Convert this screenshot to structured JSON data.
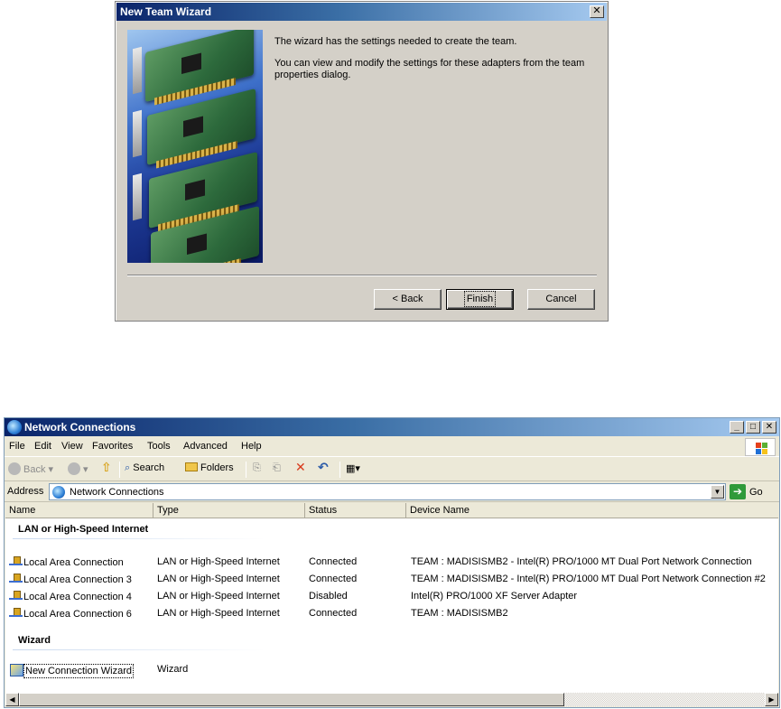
{
  "wizard": {
    "title": "New Team Wizard",
    "close": "✕",
    "message1": "The wizard has the settings needed to create the team.",
    "message2": "You can view and modify the settings for these adapters from the team properties dialog.",
    "back_label": "< Back",
    "finish_label": "Finish",
    "cancel_label": "Cancel"
  },
  "explorer": {
    "title": "Network Connections",
    "controls": {
      "minimize": "_",
      "maximize": "□",
      "close": "✕"
    },
    "menu": [
      "File",
      "Edit",
      "View",
      "Favorites",
      "Tools",
      "Advanced",
      "Help"
    ],
    "toolbar": {
      "back": "Back",
      "search": "Search",
      "folders": "Folders"
    },
    "address": {
      "label": "Address",
      "value": "Network Connections",
      "go": "Go"
    },
    "columns": [
      "Name",
      "Type",
      "Status",
      "Device Name"
    ],
    "groups": {
      "lan": "LAN or High-Speed Internet",
      "wizard": "Wizard"
    },
    "rows": [
      {
        "name": "Local Area Connection",
        "type": "LAN or High-Speed Internet",
        "status": "Connected",
        "device": "TEAM : MADISISMB2 - Intel(R) PRO/1000 MT Dual Port Network Connection"
      },
      {
        "name": "Local Area Connection 3",
        "type": "LAN or High-Speed Internet",
        "status": "Connected",
        "device": "TEAM : MADISISMB2 - Intel(R) PRO/1000 MT Dual Port Network Connection #2"
      },
      {
        "name": "Local Area Connection 4",
        "type": "LAN or High-Speed Internet",
        "status": "Disabled",
        "device": "Intel(R) PRO/1000 XF Server Adapter"
      },
      {
        "name": "Local Area Connection 6",
        "type": "LAN or High-Speed Internet",
        "status": "Connected",
        "device": "TEAM : MADISISMB2"
      }
    ],
    "wizard_row": {
      "name": "New Connection Wizard",
      "type": "Wizard"
    }
  },
  "colors": {
    "titlebar": "#0a246a",
    "face": "#d4d0c8",
    "explorer_bg": "#ece9d8"
  }
}
